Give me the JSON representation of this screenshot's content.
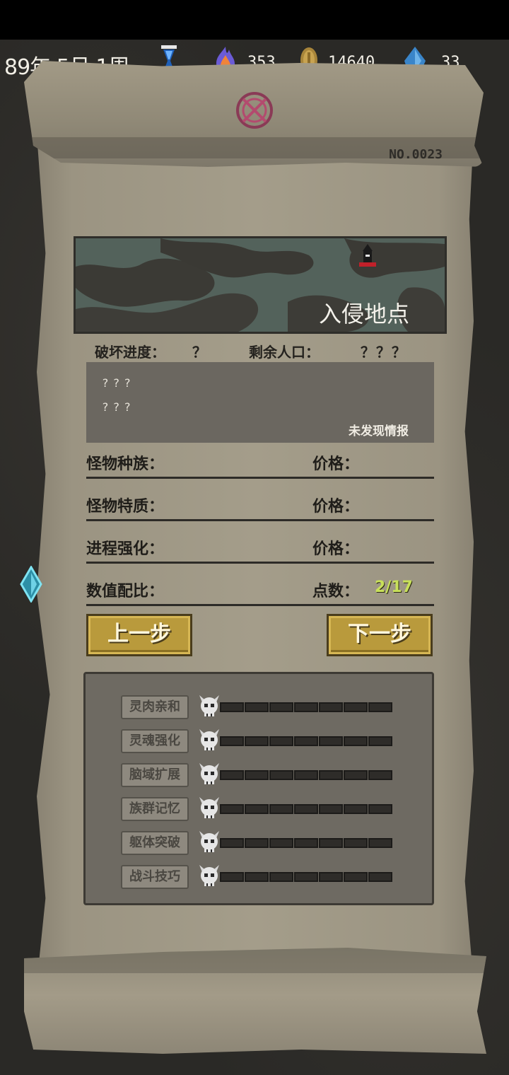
{
  "hud": {
    "date": "89年 5月 1周",
    "soul_fire": "353",
    "coins": "14640",
    "crystals": "33"
  },
  "scroll": {
    "serial": "NO.0023"
  },
  "map": {
    "label": "入侵地点"
  },
  "stats": {
    "destroy_label": "破坏进度：",
    "destroy_value": "？",
    "population_label": "剩余人口：",
    "population_value": "？？？"
  },
  "intel": {
    "line1": "???",
    "line2": "???",
    "note": "未发现情报"
  },
  "rows": [
    {
      "label": "怪物种族：",
      "right_label": "价格：",
      "right_value": ""
    },
    {
      "label": "怪物特质：",
      "right_label": "价格：",
      "right_value": ""
    },
    {
      "label": "进程强化：",
      "right_label": "价格：",
      "right_value": ""
    },
    {
      "label": "数值配比：",
      "right_label": "点数：",
      "right_value": "2/17"
    }
  ],
  "buttons": {
    "prev": "上一步",
    "next": "下一步"
  },
  "traits": [
    {
      "label": "灵肉亲和",
      "level": 0,
      "max": 7
    },
    {
      "label": "灵魂强化",
      "level": 0,
      "max": 7
    },
    {
      "label": "脑域扩展",
      "level": 0,
      "max": 7
    },
    {
      "label": "族群记忆",
      "level": 0,
      "max": 7
    },
    {
      "label": "躯体突破",
      "level": 0,
      "max": 7
    },
    {
      "label": "战斗技巧",
      "level": 0,
      "max": 7
    }
  ],
  "colors": {
    "points_accent": "#c8e05a",
    "button_gold": "#b99a3c"
  },
  "icons": [
    "hourglass-icon",
    "soul-fire-icon",
    "coin-icon",
    "crystal-icon",
    "sigil-icon",
    "tower-marker-icon",
    "skull-icon",
    "side-gem-icon"
  ]
}
